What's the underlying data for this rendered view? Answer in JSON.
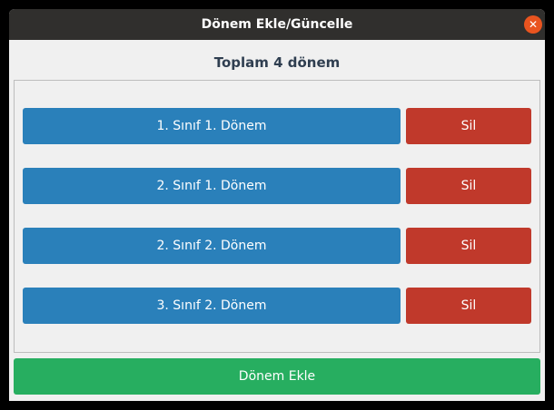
{
  "window": {
    "title": "Dönem Ekle/Güncelle",
    "close_glyph": "✕"
  },
  "heading": "Toplam 4 dönem",
  "terms": [
    {
      "label": "1. Sınıf 1. Dönem",
      "delete_label": "Sil"
    },
    {
      "label": "2. Sınıf 1. Dönem",
      "delete_label": "Sil"
    },
    {
      "label": "2. Sınıf 2. Dönem",
      "delete_label": "Sil"
    },
    {
      "label": "3. Sınıf 2. Dönem",
      "delete_label": "Sil"
    }
  ],
  "add_button_label": "Dönem Ekle",
  "colors": {
    "titlebar": "#302f2d",
    "close": "#e9541f",
    "term_button": "#2a80ba",
    "delete_button": "#c0392b",
    "add_button": "#27ae60",
    "heading_text": "#2f3e50"
  }
}
